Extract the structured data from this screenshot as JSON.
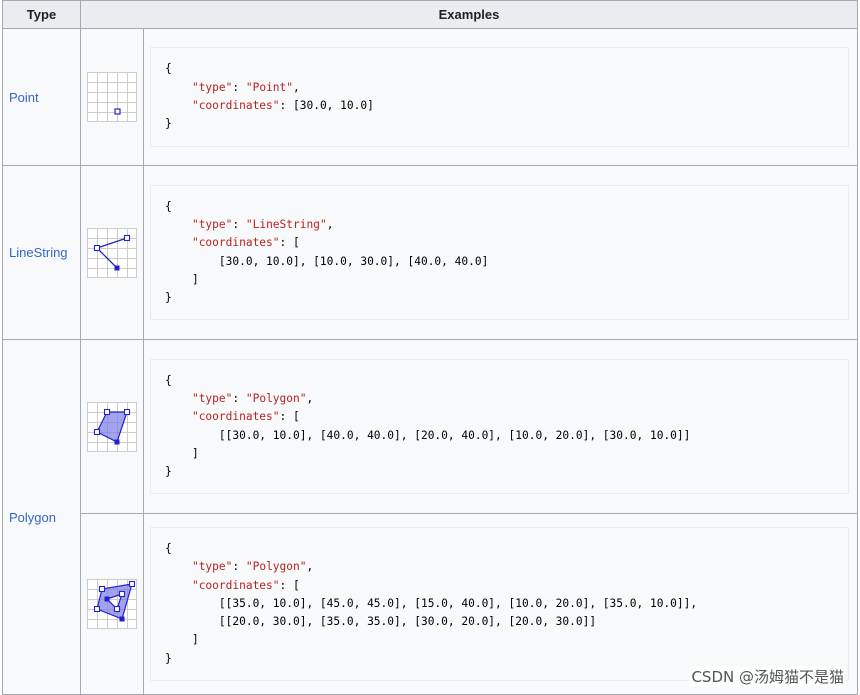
{
  "header": {
    "type_label": "Type",
    "examples_label": "Examples"
  },
  "rows": [
    {
      "type": "Point",
      "icon": "point-icon",
      "code": {
        "open": "{",
        "type_key": "\"type\"",
        "type_val": "\"Point\"",
        "coords_key": "\"coordinates\"",
        "coords_inline": "[30.0, 10.0]",
        "close": "}"
      }
    },
    {
      "type": "LineString",
      "icon": "linestring-icon",
      "code": {
        "open": "{",
        "type_key": "\"type\"",
        "type_val": "\"LineString\"",
        "coords_key": "\"coordinates\"",
        "line1": "[30.0, 10.0], [10.0, 30.0], [40.0, 40.0]",
        "bracket_close": "]",
        "close": "}"
      }
    },
    {
      "type": "Polygon",
      "icon": "polygon-icon",
      "code": {
        "open": "{",
        "type_key": "\"type\"",
        "type_val": "\"Polygon\"",
        "coords_key": "\"coordinates\"",
        "line1": "[[30.0, 10.0], [40.0, 40.0], [20.0, 40.0], [10.0, 20.0], [30.0, 10.0]]",
        "bracket_close": "]",
        "close": "}"
      }
    },
    {
      "type": "",
      "icon": "polygon-with-hole-icon",
      "code": {
        "open": "{",
        "type_key": "\"type\"",
        "type_val": "\"Polygon\"",
        "coords_key": "\"coordinates\"",
        "line1": "[[35.0, 10.0], [45.0, 45.0], [15.0, 40.0], [10.0, 20.0], [35.0, 10.0]],",
        "line2": "[[20.0, 30.0], [35.0, 35.0], [30.0, 20.0], [20.0, 30.0]]",
        "bracket_close": "]",
        "close": "}"
      }
    }
  ],
  "watermark": "CSDN @汤姆猫不是猫"
}
